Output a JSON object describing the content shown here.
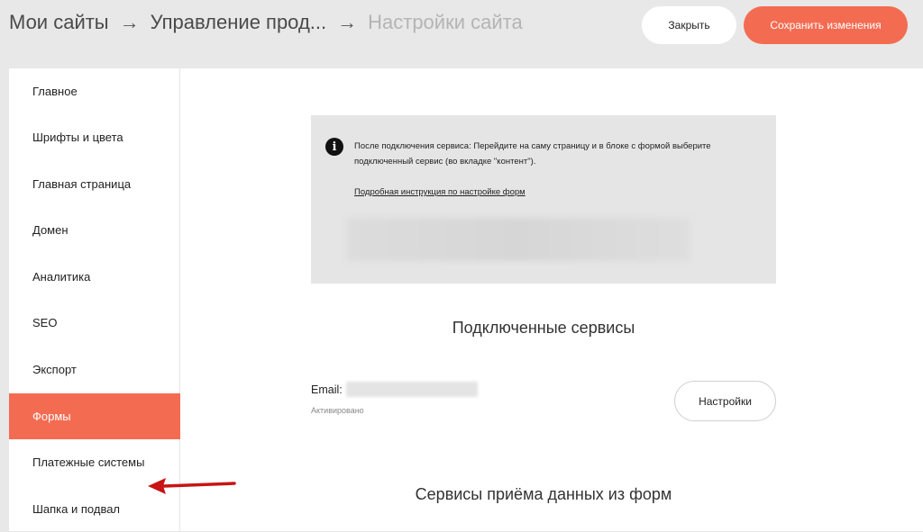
{
  "breadcrumbs": {
    "items": [
      "Мои сайты",
      "Управление прод...",
      "Настройки сайта"
    ],
    "separator": "→"
  },
  "header": {
    "close_label": "Закрыть",
    "save_label": "Сохранить изменения"
  },
  "sidebar": {
    "items": [
      {
        "label": "Главное"
      },
      {
        "label": "Шрифты и цвета"
      },
      {
        "label": "Главная страница"
      },
      {
        "label": "Домен"
      },
      {
        "label": "Аналитика"
      },
      {
        "label": "SEO"
      },
      {
        "label": "Экспорт"
      },
      {
        "label": "Формы",
        "active": true
      },
      {
        "label": "Платежные системы"
      },
      {
        "label": "Шапка и подвал"
      }
    ]
  },
  "info": {
    "icon": "info-icon",
    "glyph": "i",
    "text": "После подключения сервиса: Перейдите на саму страницу и в блоке с формой выберите подключенный сервис (во вкладке \"контент\").",
    "link": "Подробная инструкция по настройке форм"
  },
  "connected": {
    "title": "Подключенные сервисы",
    "email_label": "Email:",
    "status": "Активировано",
    "settings_label": "Настройки"
  },
  "receivers": {
    "title": "Сервисы приёма данных из форм"
  },
  "colors": {
    "accent": "#f36c52",
    "annotation_arrow": "#c81414"
  }
}
